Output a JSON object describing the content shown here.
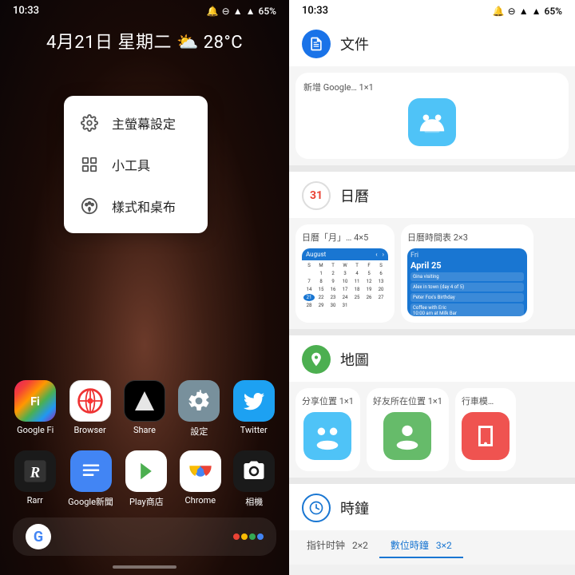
{
  "left": {
    "status_time": "10:33",
    "battery": "65%",
    "date": "4月21日 星期二 ⛅ 28°C",
    "context_menu": {
      "items": [
        {
          "id": "home-settings",
          "label": "主螢幕設定",
          "icon": "gear"
        },
        {
          "id": "widgets",
          "label": "小工具",
          "icon": "widgets"
        },
        {
          "id": "wallpaper",
          "label": "樣式和桌布",
          "icon": "palette"
        }
      ]
    },
    "dock_row1": [
      {
        "id": "google-fi",
        "label": "Google Fi",
        "color": "icon-google-fi"
      },
      {
        "id": "browser",
        "label": "Browser",
        "color": "icon-browser"
      },
      {
        "id": "share",
        "label": "Share",
        "color": "icon-share"
      },
      {
        "id": "settings",
        "label": "設定",
        "color": "icon-settings"
      },
      {
        "id": "twitter",
        "label": "Twitter",
        "color": "icon-twitter"
      }
    ],
    "dock_row2": [
      {
        "id": "rarr",
        "label": "Rarr",
        "color": "icon-rarr"
      },
      {
        "id": "news",
        "label": "Google新聞",
        "color": "icon-news"
      },
      {
        "id": "play",
        "label": "Play商店",
        "color": "icon-play"
      },
      {
        "id": "chrome",
        "label": "Chrome",
        "color": "icon-chrome"
      },
      {
        "id": "camera",
        "label": "相機",
        "color": "icon-camera"
      }
    ]
  },
  "right": {
    "status_time": "10:33",
    "battery": "65%",
    "sections": [
      {
        "id": "documents",
        "app_name": "文件",
        "app_color": "#1a73e8",
        "rows": [
          {
            "label": "新增 Google…  1×1",
            "type": "single",
            "has_android_icon": true
          }
        ]
      },
      {
        "id": "calendar",
        "app_name": "日曆",
        "app_color": "#ea4335",
        "rows": [
          {
            "cards": [
              {
                "label": "日曆「月」…  4×5",
                "type": "calendar"
              },
              {
                "label": "日曆時間表  2×3",
                "type": "agenda"
              }
            ]
          }
        ]
      },
      {
        "id": "maps",
        "app_name": "地圖",
        "app_color": "#4caf50",
        "rows": [
          {
            "cards": [
              {
                "label": "分享位置  1×1",
                "type": "android"
              },
              {
                "label": "好友所在位置  1×1",
                "type": "android"
              },
              {
                "label": "行車模…",
                "type": "android"
              }
            ]
          }
        ]
      },
      {
        "id": "clock",
        "app_name": "時鐘",
        "app_color": "#1976d2",
        "tabs": [
          {
            "label": "指针时钟",
            "size": "2×2",
            "active": false
          },
          {
            "label": "數位時鐘",
            "size": "3×2",
            "active": true
          }
        ]
      }
    ]
  }
}
